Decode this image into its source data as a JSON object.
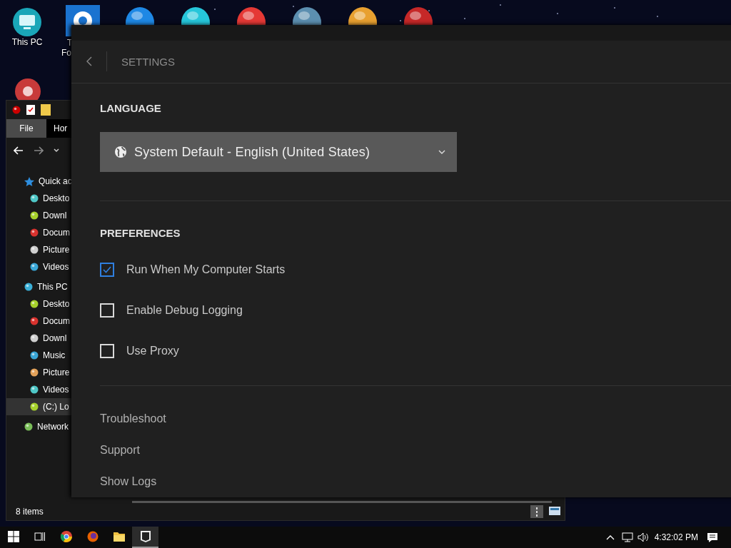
{
  "desktop_icons": [
    {
      "label_lines": [
        "This PC"
      ]
    },
    {
      "label_lines": [
        "T",
        "Fo"
      ]
    }
  ],
  "explorer": {
    "tabs": [
      {
        "label": "File",
        "selected": true
      },
      {
        "label": "Hor",
        "selected": false
      }
    ],
    "tree": [
      {
        "label": "Quick ac",
        "selected": false,
        "children": [
          {
            "label": "Deskto",
            "selected": false
          },
          {
            "label": "Downl",
            "selected": false
          },
          {
            "label": "Docum",
            "selected": false
          },
          {
            "label": "Picture",
            "selected": false
          },
          {
            "label": "Videos",
            "selected": false
          }
        ]
      },
      {
        "label": "This PC",
        "selected": false,
        "children": [
          {
            "label": "Deskto",
            "selected": false
          },
          {
            "label": "Docum",
            "selected": false
          },
          {
            "label": "Downl",
            "selected": false
          },
          {
            "label": "Music",
            "selected": false
          },
          {
            "label": "Picture",
            "selected": false
          },
          {
            "label": "Videos",
            "selected": false
          },
          {
            "label": "(C:) Lo",
            "selected": true
          }
        ]
      },
      {
        "label": "Network",
        "selected": false
      }
    ],
    "status_bar": {
      "items": "8 items"
    }
  },
  "settings": {
    "title": "SETTINGS",
    "language": {
      "heading": "LANGUAGE",
      "value": "System Default - English (United States)"
    },
    "preferences": {
      "heading": "PREFERENCES",
      "options": [
        {
          "label": "Run When My Computer Starts",
          "checked": true
        },
        {
          "label": "Enable Debug Logging",
          "checked": false
        },
        {
          "label": "Use Proxy",
          "checked": false
        }
      ]
    },
    "links": [
      "Troubleshoot",
      "Support",
      "Show Logs"
    ]
  },
  "taskbar": {
    "apps": [
      {
        "kind": "chrome",
        "active": false
      },
      {
        "kind": "firefox",
        "active": false
      },
      {
        "kind": "folder",
        "active": false
      },
      {
        "kind": "epic",
        "active": true
      }
    ],
    "time": "4:32:02 PM"
  }
}
